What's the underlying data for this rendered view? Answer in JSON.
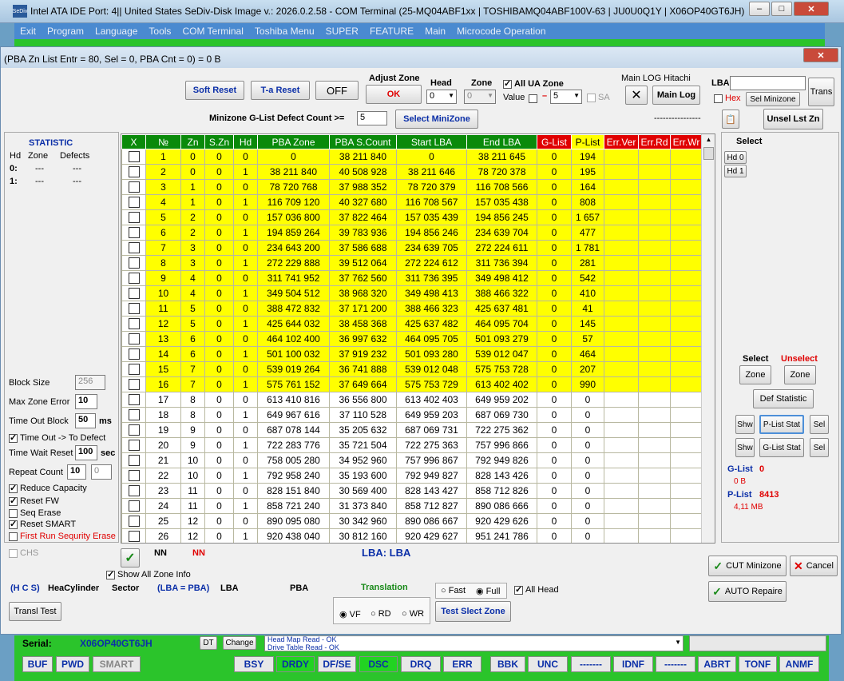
{
  "outer": {
    "title": "Intel ATA IDE  Port: 4|| United States  SeDiv-Disk Image v.: 2026.0.2.58 - COM Terminal  (25-MQ04ABF1xx  | TOSHIBAMQ04ABF100V-63 | JU0U0Q1Y | X06OP40GT6JH)",
    "menu": [
      "Exit",
      "Program",
      "Language",
      "Tools",
      "COM Terminal",
      "Toshiba Menu",
      "SUPER",
      "FEATURE",
      "Main",
      "Microcode Operation"
    ]
  },
  "dialog": {
    "title": "(PBA Zn List Entr = 80, Sel = 0, PBA Cnt = 0) = 0 B",
    "toolbar": {
      "soft_reset": "Soft Reset",
      "ta_reset": "T-a Reset",
      "off": "OFF",
      "adjust_zone_label": "Adjust Zone",
      "ok": "OK",
      "head_label": "Head",
      "head_value": "0",
      "zone_label": "Zone",
      "zone_value": "0",
      "all_ua_zone": "All UA Zone",
      "value_label": "Value",
      "value_sel": "5",
      "sa": "SA",
      "main_log_label": "Main LOG Hitachi",
      "main_log_btn": "Main Log",
      "lba_label": "LBA",
      "hex": "Hex",
      "sel_minizone": "Sel Minizone",
      "trans": "Trans",
      "minizone_label": "Minizone G-List Defect Count >=",
      "minizone_value": "5",
      "select_minizone": "Select MiniZone",
      "dashes": "----------------",
      "unsel_lst": "Unsel Lst Zn"
    },
    "statistic": {
      "title": "STATISTIC",
      "headers": [
        "Hd",
        "Zone",
        "Defects"
      ],
      "rows": [
        [
          "0:",
          "---",
          "---"
        ],
        [
          "1:",
          "---",
          "---"
        ]
      ]
    },
    "left_params": {
      "block_size_label": "Block Size",
      "block_size": "256",
      "max_zone_error_label": "Max Zone Error",
      "max_zone_error": "10",
      "timeout_block_label": "Time Out Block",
      "timeout_block": "50",
      "ms": "ms",
      "timeout_defect": "Time Out  -> To Defect",
      "time_wait_reset_label": "Time Wait Reset",
      "time_wait_reset": "100",
      "sec": "sec",
      "repeat_count_label": "Repeat Count",
      "repeat_count": "10",
      "repeat_count2": "0",
      "reduce_capacity": "Reduce Capacity",
      "reset_fw": "Reset FW",
      "seq_erase": "Seq Erase",
      "reset_smart": "Reset SMART",
      "first_run": "First Run Sequrity Erase",
      "chs": "CHS"
    },
    "table": {
      "headers": [
        "X",
        "№",
        "Zn",
        "S.Zn",
        "Hd",
        "PBA Zone",
        "PBA S.Count",
        "Start LBA",
        "End LBA",
        "G-List",
        "P-List",
        "Err.Ver",
        "Err.Rd",
        "Err.Wr"
      ],
      "rows": [
        [
          "1",
          "0",
          "0",
          "0",
          "0",
          "38 211 840",
          "0",
          "38 211 645",
          "0",
          "194"
        ],
        [
          "2",
          "0",
          "0",
          "1",
          "38 211 840",
          "40 508 928",
          "38 211 646",
          "78 720 378",
          "0",
          "195"
        ],
        [
          "3",
          "1",
          "0",
          "0",
          "78 720 768",
          "37 988 352",
          "78 720 379",
          "116 708 566",
          "0",
          "164"
        ],
        [
          "4",
          "1",
          "0",
          "1",
          "116 709 120",
          "40 327 680",
          "116 708 567",
          "157 035 438",
          "0",
          "808"
        ],
        [
          "5",
          "2",
          "0",
          "0",
          "157 036 800",
          "37 822 464",
          "157 035 439",
          "194 856 245",
          "0",
          "1 657"
        ],
        [
          "6",
          "2",
          "0",
          "1",
          "194 859 264",
          "39 783 936",
          "194 856 246",
          "234 639 704",
          "0",
          "477"
        ],
        [
          "7",
          "3",
          "0",
          "0",
          "234 643 200",
          "37 586 688",
          "234 639 705",
          "272 224 611",
          "0",
          "1 781"
        ],
        [
          "8",
          "3",
          "0",
          "1",
          "272 229 888",
          "39 512 064",
          "272 224 612",
          "311 736 394",
          "0",
          "281"
        ],
        [
          "9",
          "4",
          "0",
          "0",
          "311 741 952",
          "37 762 560",
          "311 736 395",
          "349 498 412",
          "0",
          "542"
        ],
        [
          "10",
          "4",
          "0",
          "1",
          "349 504 512",
          "38 968 320",
          "349 498 413",
          "388 466 322",
          "0",
          "410"
        ],
        [
          "11",
          "5",
          "0",
          "0",
          "388 472 832",
          "37 171 200",
          "388 466 323",
          "425 637 481",
          "0",
          "41"
        ],
        [
          "12",
          "5",
          "0",
          "1",
          "425 644 032",
          "38 458 368",
          "425 637 482",
          "464 095 704",
          "0",
          "145"
        ],
        [
          "13",
          "6",
          "0",
          "0",
          "464 102 400",
          "36 997 632",
          "464 095 705",
          "501 093 279",
          "0",
          "57"
        ],
        [
          "14",
          "6",
          "0",
          "1",
          "501 100 032",
          "37 919 232",
          "501 093 280",
          "539 012 047",
          "0",
          "464"
        ],
        [
          "15",
          "7",
          "0",
          "0",
          "539 019 264",
          "36 741 888",
          "539 012 048",
          "575 753 728",
          "0",
          "207"
        ],
        [
          "16",
          "7",
          "0",
          "1",
          "575 761 152",
          "37 649 664",
          "575 753 729",
          "613 402 402",
          "0",
          "990"
        ],
        [
          "17",
          "8",
          "0",
          "0",
          "613 410 816",
          "36 556 800",
          "613 402 403",
          "649 959 202",
          "0",
          "0"
        ],
        [
          "18",
          "8",
          "0",
          "1",
          "649 967 616",
          "37 110 528",
          "649 959 203",
          "687 069 730",
          "0",
          "0"
        ],
        [
          "19",
          "9",
          "0",
          "0",
          "687 078 144",
          "35 205 632",
          "687 069 731",
          "722 275 362",
          "0",
          "0"
        ],
        [
          "20",
          "9",
          "0",
          "1",
          "722 283 776",
          "35 721 504",
          "722 275 363",
          "757 996 866",
          "0",
          "0"
        ],
        [
          "21",
          "10",
          "0",
          "0",
          "758 005 280",
          "34 952 960",
          "757 996 867",
          "792 949 826",
          "0",
          "0"
        ],
        [
          "22",
          "10",
          "0",
          "1",
          "792 958 240",
          "35 193 600",
          "792 949 827",
          "828 143 426",
          "0",
          "0"
        ],
        [
          "23",
          "11",
          "0",
          "0",
          "828 151 840",
          "30 569 400",
          "828 143 427",
          "858 712 826",
          "0",
          "0"
        ],
        [
          "24",
          "11",
          "0",
          "1",
          "858 721 240",
          "31 373 840",
          "858 712 827",
          "890 086 666",
          "0",
          "0"
        ],
        [
          "25",
          "12",
          "0",
          "0",
          "890 095 080",
          "30 342 960",
          "890 086 667",
          "920 429 626",
          "0",
          "0"
        ],
        [
          "26",
          "12",
          "0",
          "1",
          "920 438 040",
          "30 812 160",
          "920 429 627",
          "951 241 786",
          "0",
          "0"
        ]
      ],
      "yellow_rows": 16
    },
    "right": {
      "select_label": "Select",
      "hd0": "Hd 0",
      "hd1": "Hd 1",
      "select2": "Select",
      "unselect": "Unselect",
      "zone1": "Zone",
      "zone2": "Zone",
      "def_statistic": "Def Statistic",
      "shw1": "Shw",
      "plist_stat": "P-List Stat",
      "sel1": "Sel",
      "shw2": "Shw",
      "glist_stat": "G-List Stat",
      "sel2": "Sel",
      "glist_label": "G-List",
      "glist_value": "0",
      "glist_size": "0 B",
      "plist_label": "P-List",
      "plist_value": "8413",
      "plist_size": "4,11 MB"
    },
    "bottom": {
      "nn1": "NN",
      "nn2": "NN",
      "lba_lba": "LBA: LBA",
      "show_all_zone": "Show All Zone Info",
      "hcs": "(H C S)",
      "headcylinder": "HeaCylinder",
      "sector": "Sector",
      "lba_pba": "(LBA = PBA)",
      "lba": "LBA",
      "pba": "PBA",
      "translation": "Translation",
      "fast": "Fast",
      "full": "Full",
      "all_head": "All Head",
      "transl_test": "Transl Test",
      "vf": "VF",
      "rd": "RD",
      "wr": "WR",
      "test_slect_zone": "Test Slect Zone",
      "cut_minizone": "CUT Minizone",
      "cancel": "Cancel",
      "auto_repaire": "AUTO Repaire"
    }
  },
  "status": {
    "serial_label": "Serial:",
    "serial_value": "X06OP40GT6JH",
    "dt": "DT",
    "change": "Change",
    "log1": "Head Map Read - OK",
    "log2": "Drive Table Read - OK",
    "buttons": [
      "BUF",
      "PWD",
      "SMART",
      "BSY",
      "DRDY",
      "DF/SE",
      "DSC",
      "DRQ",
      "ERR",
      "BBK",
      "UNC",
      "-------",
      "IDNF",
      "-------",
      "ABRT",
      "TONF",
      "ANMF"
    ]
  }
}
